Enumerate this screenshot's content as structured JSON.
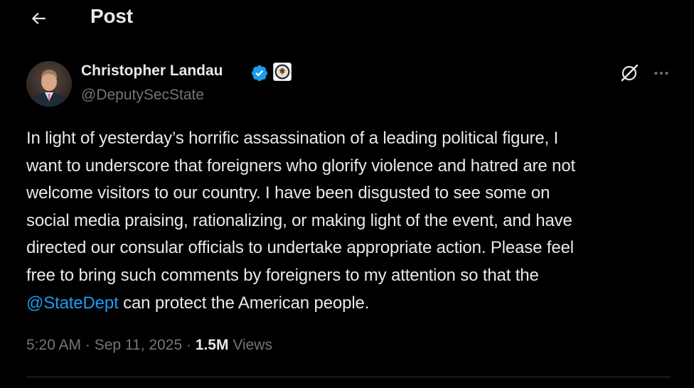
{
  "header": {
    "title": "Post"
  },
  "author": {
    "name": "Christopher Landau",
    "handle": "@DeputySecState"
  },
  "post": {
    "lines": [
      "In light of yesterday’s horrific assassination of a leading political figure, I",
      "want to underscore that foreigners who glorify violence and hatred are not",
      "welcome visitors to our country. I have been disgusted to see some on",
      "social media praising, rationalizing, or making light of the event, and have",
      "directed our consular officials to undertake appropriate action. Please feel",
      "free to bring such comments by foreigners to my attention so that the"
    ],
    "mention": "@StateDept",
    "last_line_rest": " can protect the American people."
  },
  "meta": {
    "time": "5:20 AM",
    "separator": " · ",
    "date": "Sep 11, 2025",
    "views_count": "1.5M",
    "views_label": " Views"
  },
  "colors": {
    "background": "#000000",
    "text": "#e7e9ea",
    "secondary": "#71767b",
    "link": "#1d9bf0",
    "verified": "#1d9bf0",
    "divider": "#2f3336"
  },
  "icons": {
    "back": "arrow-left-icon",
    "verified": "verified-badge-icon",
    "affiliation": "state-department-seal-icon",
    "grok": "grok-icon",
    "more": "more-horizontal-icon"
  }
}
